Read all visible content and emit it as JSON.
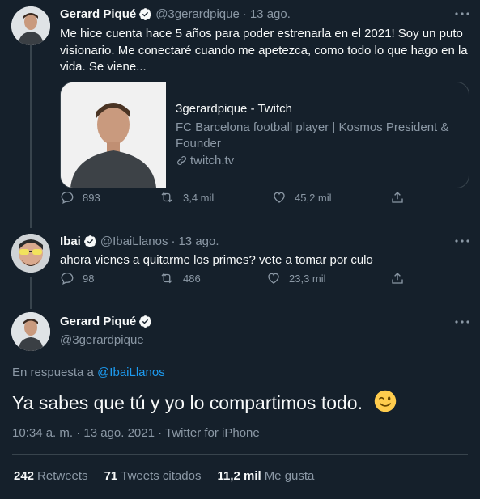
{
  "tweet1": {
    "name": "Gerard Piqué",
    "handle": "@3gerardpique",
    "time": "13 ago.",
    "text": "Me hice cuenta hace 5 años para poder estrenarla en el 2021! Soy un puto visionario. Me conectaré cuando me apetezca, como todo lo que hago en la vida. Se viene...",
    "card": {
      "title": "3gerardpique - Twitch",
      "description": "FC Barcelona football player | Kosmos President & Founder",
      "domain": "twitch.tv"
    },
    "replies": "893",
    "retweets": "3,4 mil",
    "likes": "45,2 mil"
  },
  "tweet2": {
    "name": "Ibai",
    "handle": "@IbaiLlanos",
    "time": "13 ago.",
    "text": "ahora vienes a quitarme los primes? vete a tomar por culo",
    "replies": "98",
    "retweets": "486",
    "likes": "23,3 mil"
  },
  "main_tweet": {
    "name": "Gerard Piqué",
    "handle": "@3gerardpique",
    "reply_prefix": "En respuesta a",
    "reply_to": "@IbaiLlanos",
    "text": "Ya sabes que tú y yo lo compartimos todo.",
    "emoji": "😉",
    "timestamp": "10:34 a. m. · 13 ago. 2021 · Twitter for iPhone",
    "stats": {
      "retweets_count": "242",
      "retweets_label": "Retweets",
      "quotes_count": "71",
      "quotes_label": "Tweets citados",
      "likes_count": "11,2 mil",
      "likes_label": "Me gusta"
    }
  },
  "colors": {
    "background": "#15202b",
    "text": "#f7f9f9",
    "muted": "#8b98a5",
    "accent": "#1d9bf0",
    "border": "#38444d"
  }
}
